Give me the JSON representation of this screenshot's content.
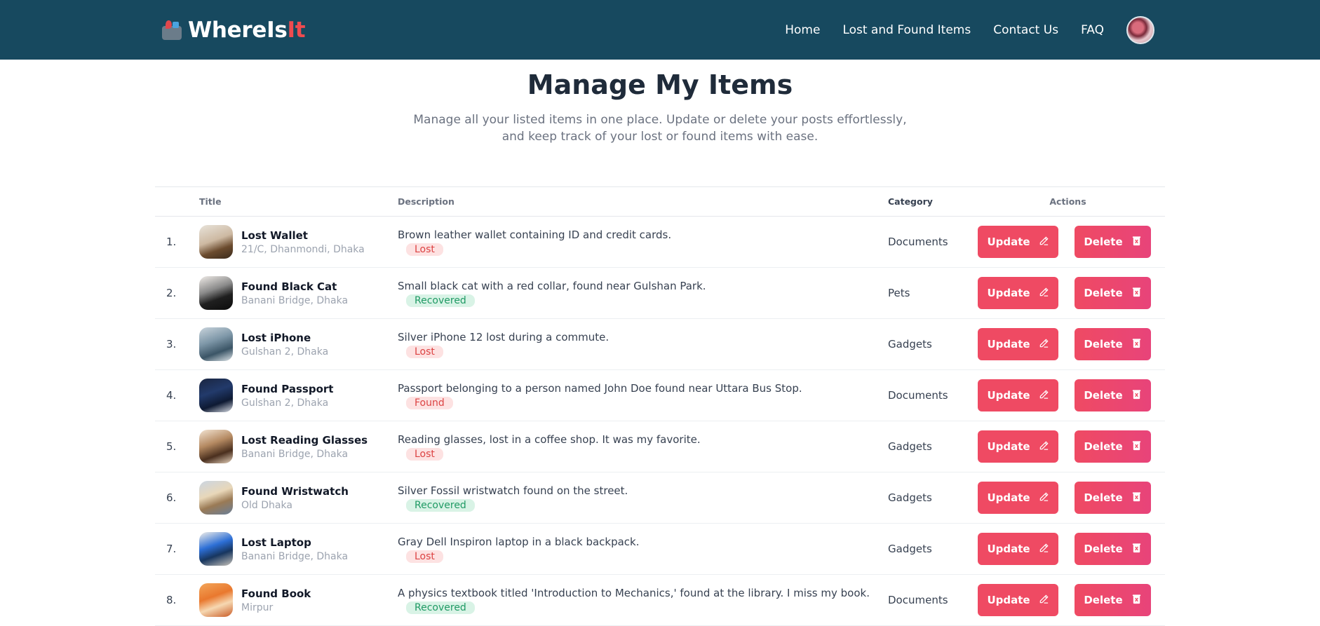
{
  "brand": {
    "name_main": "WhereIs",
    "name_accent": "It"
  },
  "nav": {
    "items": [
      "Home",
      "Lost and Found Items",
      "Contact Us",
      "FAQ"
    ]
  },
  "hero": {
    "title": "Manage My Items",
    "subtitle": "Manage all your listed items in one place. Update or delete your posts effortlessly, and keep track of your lost or found items with ease."
  },
  "table": {
    "headers": {
      "title": "Title",
      "description": "Description",
      "category": "Category",
      "actions": "Actions"
    },
    "update_label": "Update",
    "delete_label": "Delete",
    "rows": [
      {
        "num": "1.",
        "title": "Lost Wallet",
        "location": "21/C, Dhanmondi, Dhaka",
        "description": "Brown leather wallet containing ID and credit cards.",
        "status": "Lost",
        "category": "Documents"
      },
      {
        "num": "2.",
        "title": "Found Black Cat",
        "location": "Banani Bridge, Dhaka",
        "description": "Small black cat with a red collar, found near Gulshan Park.",
        "status": "Recovered",
        "category": "Pets"
      },
      {
        "num": "3.",
        "title": "Lost iPhone",
        "location": "Gulshan 2, Dhaka",
        "description": "Silver iPhone 12 lost during a commute.",
        "status": "Lost",
        "category": "Gadgets"
      },
      {
        "num": "4.",
        "title": "Found Passport",
        "location": "Gulshan 2, Dhaka",
        "description": "Passport belonging to a person named John Doe found near Uttara Bus Stop.",
        "status": "Found",
        "category": "Documents"
      },
      {
        "num": "5.",
        "title": "Lost Reading Glasses",
        "location": "Banani Bridge, Dhaka",
        "description": "Reading glasses, lost in a coffee shop. It was my favorite.",
        "status": "Lost",
        "category": "Gadgets"
      },
      {
        "num": "6.",
        "title": "Found Wristwatch",
        "location": "Old Dhaka",
        "description": "Silver Fossil wristwatch found on the street.",
        "status": "Recovered",
        "category": "Gadgets"
      },
      {
        "num": "7.",
        "title": "Lost Laptop",
        "location": "Banani Bridge, Dhaka",
        "description": "Gray Dell Inspiron laptop in a black backpack.",
        "status": "Lost",
        "category": "Gadgets"
      },
      {
        "num": "8.",
        "title": "Found Book",
        "location": "Mirpur",
        "description": "A physics textbook titled 'Introduction to Mechanics,' found at the library. I miss my book.",
        "status": "Recovered",
        "category": "Documents"
      }
    ]
  },
  "colors": {
    "navbar": "#17495f",
    "accent": "#ef4a63",
    "brand_accent": "#ef4b4f"
  }
}
